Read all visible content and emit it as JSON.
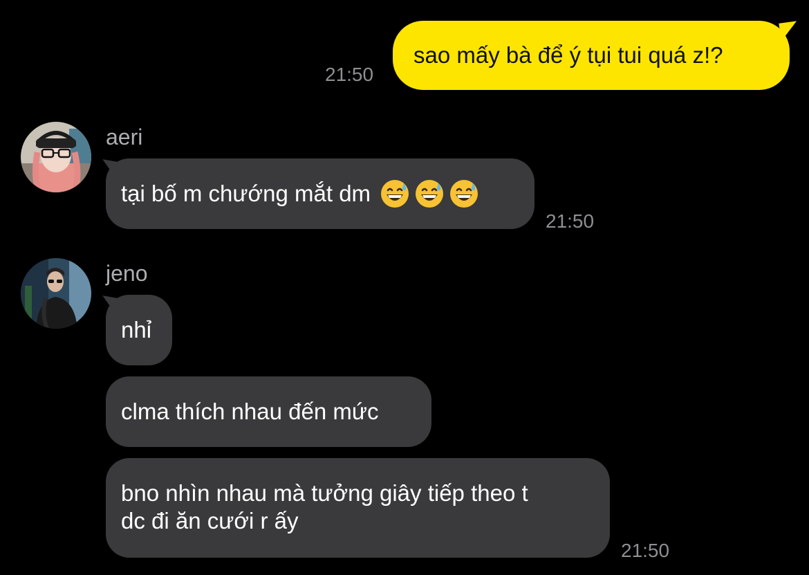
{
  "messages": [
    {
      "id": "m1",
      "direction": "outgoing",
      "text": "sao mấy bà để ý tụi tui quá z!?",
      "time": "21:50"
    },
    {
      "id": "m2",
      "direction": "incoming",
      "sender": "aeri",
      "avatar_icon": "avatar-aeri",
      "text": "tại bố m chướng mắt dm",
      "emoji": [
        "grinning-face-with-sweat",
        "grinning-face-with-sweat",
        "grinning-face-with-sweat"
      ],
      "time": "21:50"
    },
    {
      "id": "m3",
      "direction": "incoming",
      "sender": "jeno",
      "avatar_icon": "avatar-jeno",
      "text": "nhỉ"
    },
    {
      "id": "m4",
      "direction": "incoming",
      "text": "clma thích nhau đến mức"
    },
    {
      "id": "m5",
      "direction": "incoming",
      "text_line1": "bno nhìn nhau mà tưởng giây tiếp theo t",
      "text_line2": "dc đi ăn cưới r ấy",
      "time": "21:50"
    }
  ],
  "colors": {
    "background": "#000000",
    "outgoing_bubble": "#FEE500",
    "incoming_bubble": "#3A3A3C",
    "timestamp": "#8E8E93",
    "sender_name": "#AEAEB2"
  }
}
